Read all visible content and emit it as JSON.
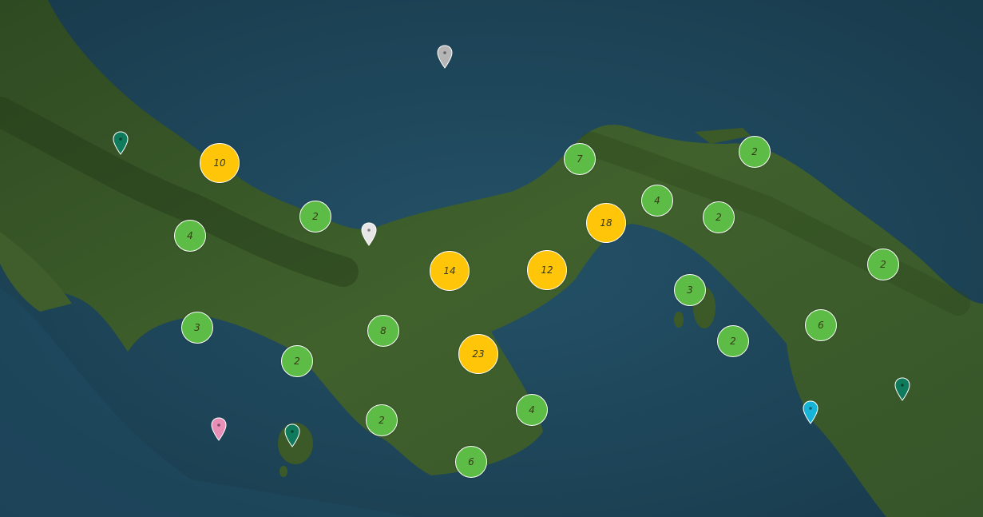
{
  "colors": {
    "cluster_small": "#5cbc45",
    "cluster_large": "#ffc609",
    "sea": "#1b4257",
    "land": "#3a5a2a"
  },
  "clusters": [
    {
      "count": "10",
      "size": "large"
    },
    {
      "count": "4",
      "size": "small"
    },
    {
      "count": "2",
      "size": "small"
    },
    {
      "count": "7",
      "size": "small"
    },
    {
      "count": "2",
      "size": "small"
    },
    {
      "count": "4",
      "size": "small"
    },
    {
      "count": "18",
      "size": "large"
    },
    {
      "count": "2",
      "size": "small"
    },
    {
      "count": "14",
      "size": "large"
    },
    {
      "count": "12",
      "size": "large"
    },
    {
      "count": "2",
      "size": "small"
    },
    {
      "count": "3",
      "size": "small"
    },
    {
      "count": "3",
      "size": "small"
    },
    {
      "count": "8",
      "size": "small"
    },
    {
      "count": "2",
      "size": "small"
    },
    {
      "count": "6",
      "size": "small"
    },
    {
      "count": "2",
      "size": "small"
    },
    {
      "count": "23",
      "size": "large"
    },
    {
      "count": "4",
      "size": "small"
    },
    {
      "count": "2",
      "size": "small"
    },
    {
      "count": "6",
      "size": "small"
    }
  ],
  "markers": [
    {
      "name": "marker-pin-gray",
      "color": "#b5b5b5"
    },
    {
      "name": "marker-pin-white",
      "color": "#e6e6e6"
    },
    {
      "name": "marker-pin-teal",
      "color": "#0f7a5c"
    },
    {
      "name": "marker-pin-pink",
      "color": "#e98fb7"
    },
    {
      "name": "marker-pin-teal",
      "color": "#0f7a5c"
    },
    {
      "name": "marker-pin-cyan",
      "color": "#17b4d8"
    },
    {
      "name": "marker-pin-teal",
      "color": "#0f7a5c"
    }
  ]
}
